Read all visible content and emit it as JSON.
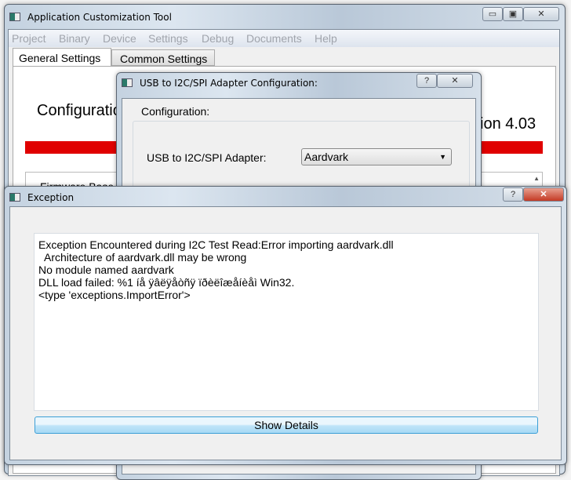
{
  "main_window": {
    "title": "Application Customization Tool",
    "menu": [
      "Project",
      "Binary",
      "Device",
      "Settings",
      "Debug",
      "Documents",
      "Help"
    ],
    "tabs": [
      "General Settings",
      "Common Settings"
    ],
    "heading_left": "Configuratio",
    "heading_right": "ion 4.03",
    "table_header": "Firmware Base",
    "accent": "#e00000"
  },
  "adapter_dialog": {
    "title": "USB to I2C/SPI Adapter Configuration:",
    "group_label": "Configuration:",
    "adapter_label": "USB to I2C/SPI Adapter:",
    "adapter_value": "Aardvark"
  },
  "exception_dialog": {
    "title": "Exception",
    "message_lines": [
      "Exception Encountered during I2C Test Read:Error importing aardvark.dll",
      "  Architecture of aardvark.dll may be wrong",
      "No module named aardvark",
      "DLL load failed: %1 íå ÿâëÿåòñÿ ïðèëîæåíèåì Win32.",
      "<type 'exceptions.ImportError'>"
    ],
    "button": "Show Details"
  }
}
